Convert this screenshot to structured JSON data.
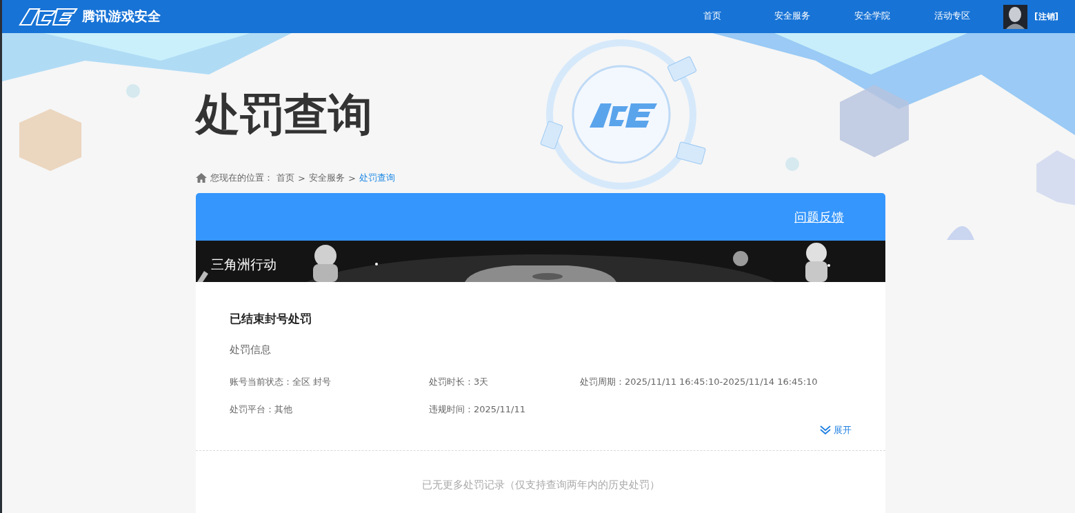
{
  "header": {
    "brand": "腾讯游戏安全",
    "nav": [
      {
        "label": "首页",
        "selected": false
      },
      {
        "label": "安全服务",
        "selected": false
      },
      {
        "label": "安全学院",
        "selected": false
      },
      {
        "label": "活动专区",
        "selected": false
      }
    ],
    "logout": "[注销]"
  },
  "page_title": "处罚查询",
  "breadcrumb": {
    "prefix": "您现在的位置：",
    "items": [
      {
        "label": "首页",
        "current": false
      },
      {
        "label": "安全服务",
        "current": false
      },
      {
        "label": "处罚查询",
        "current": true
      }
    ],
    "separator": ">"
  },
  "card": {
    "feedback_link": "问题反馈",
    "game": {
      "name": "三角洲行动",
      "kind": "picture"
    },
    "record": {
      "title": "已结束封号处罚",
      "section": "处罚信息",
      "fields": [
        {
          "label": "账号当前状态：",
          "value": "全区 封号"
        },
        {
          "label": "处罚时长：",
          "value": "3天"
        },
        {
          "label": "处罚周期：",
          "value": "2025/11/11 16:45:10-2025/11/14 16:45:10"
        },
        {
          "label": "处罚平台：",
          "value": "其他"
        },
        {
          "label": "违规时间：",
          "value": "2025/11/11"
        }
      ],
      "expand": {
        "label": "展开",
        "expanded": false
      }
    },
    "end_note": "已无更多处罚记录（仅支持查询两年内的历史处罚）"
  }
}
